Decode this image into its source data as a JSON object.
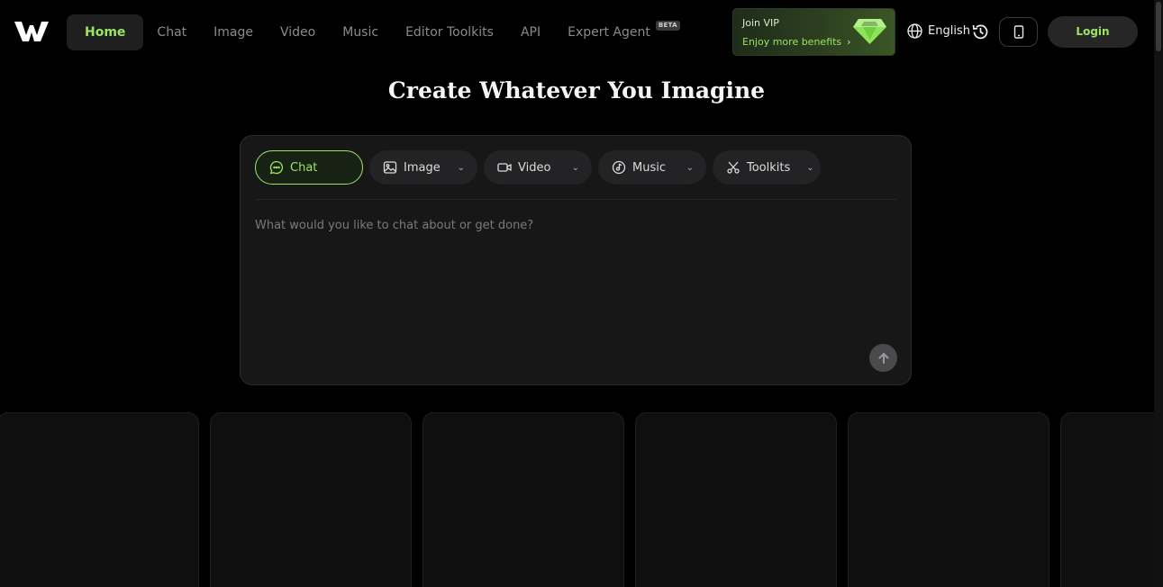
{
  "header": {
    "logo": "w-logo",
    "nav": [
      {
        "label": "Home",
        "active": true
      },
      {
        "label": "Chat"
      },
      {
        "label": "Image"
      },
      {
        "label": "Video"
      },
      {
        "label": "Music"
      },
      {
        "label": "Editor Toolkits"
      },
      {
        "label": "API"
      },
      {
        "label": "Expert Agent",
        "badge": "BETA"
      }
    ],
    "vip": {
      "title": "Join VIP",
      "subtitle": "Enjoy more benefits",
      "chevron": "›",
      "icon": "diamond-icon"
    },
    "language": {
      "label": "English",
      "icon": "globe-icon"
    },
    "history_icon": "history-icon",
    "device_icon": "mobile-icon",
    "login_label": "Login"
  },
  "hero": {
    "title": "Create Whatever You Imagine"
  },
  "composer": {
    "tabs": [
      {
        "label": "Chat",
        "icon": "chat-bubble-icon",
        "active": true
      },
      {
        "label": "Image",
        "icon": "image-icon",
        "dropdown": true
      },
      {
        "label": "Video",
        "icon": "video-icon",
        "dropdown": true
      },
      {
        "label": "Music",
        "icon": "music-icon",
        "dropdown": true
      },
      {
        "label": "Toolkits",
        "icon": "scissors-icon",
        "dropdown": true
      }
    ],
    "placeholder": "What would you like to chat about or get done?",
    "value": "",
    "send_icon": "arrow-up-icon"
  },
  "gallery": {
    "card_count": 6
  },
  "colors": {
    "accent": "#9be564",
    "background": "#000000",
    "panel": "#171718",
    "muted": "#8a8a8a"
  }
}
